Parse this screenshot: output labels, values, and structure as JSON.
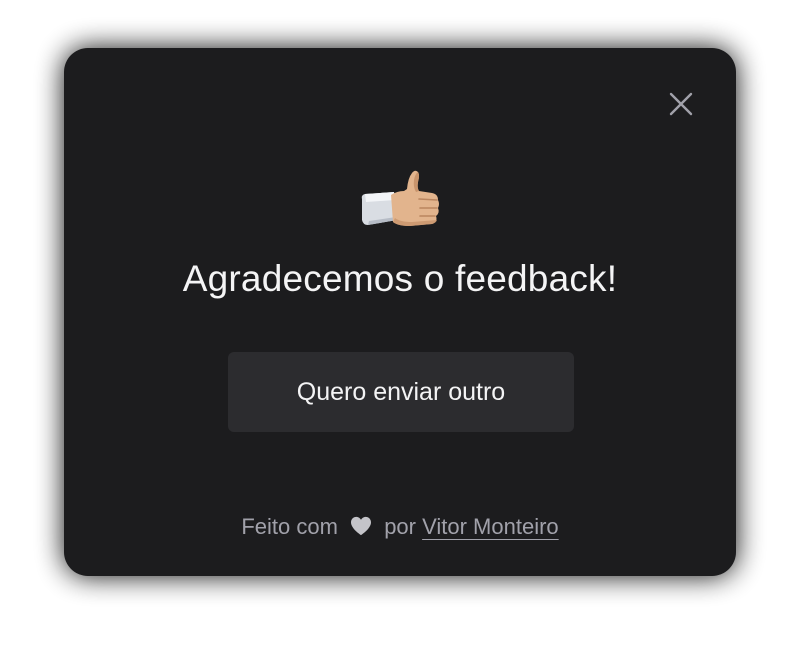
{
  "dialog": {
    "title": "Agradecemos o feedback!",
    "resend_label": "Quero enviar outro",
    "close_icon": "close-icon",
    "success_icon": "thumbs-up-icon"
  },
  "footer": {
    "made_with": "Feito com",
    "by": "por",
    "author": "Vitor Monteiro",
    "heart_icon": "heart-icon"
  },
  "colors": {
    "card_background": "#1c1c1e",
    "button_background": "#2c2c2f",
    "text_primary": "#f4f4f5",
    "text_muted": "#a1a1aa"
  }
}
